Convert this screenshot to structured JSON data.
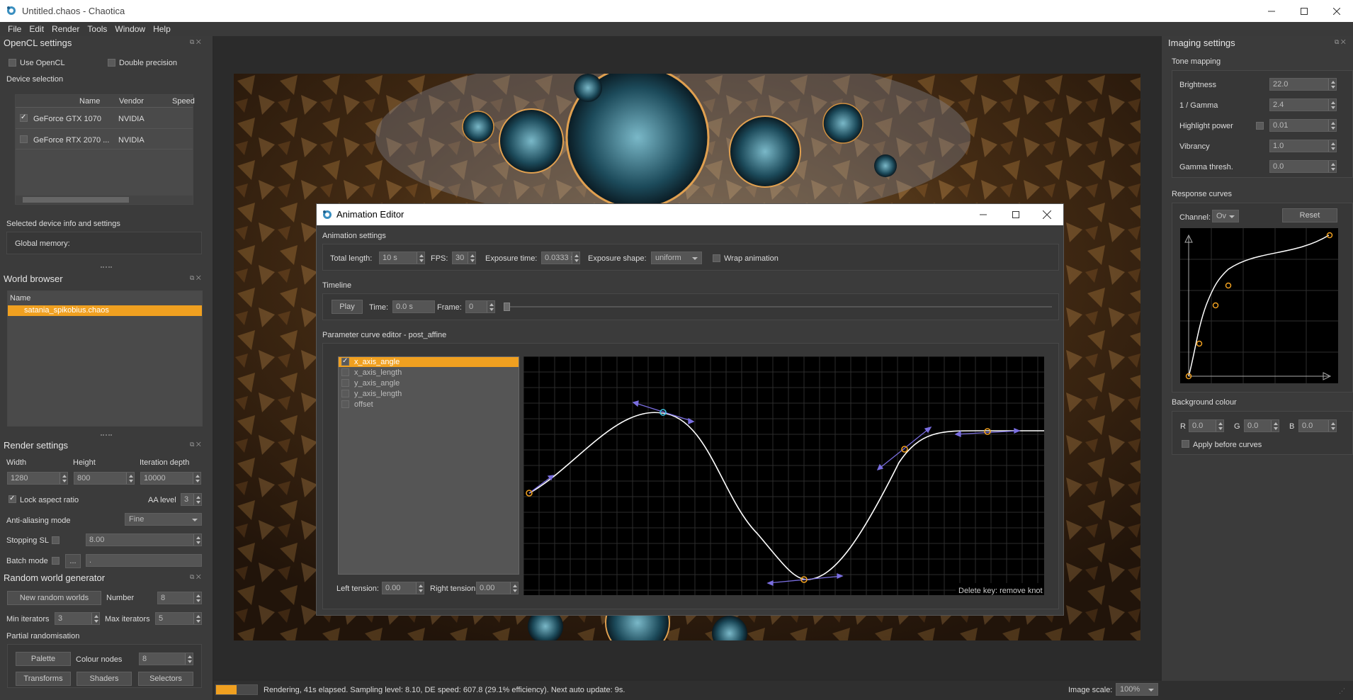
{
  "window": {
    "title": "Untitled.chaos - Chaotica"
  },
  "menu": [
    "File",
    "Edit",
    "Render",
    "Tools",
    "Window",
    "Help"
  ],
  "opencl": {
    "title": "OpenCL settings",
    "use_opencl": "Use OpenCL",
    "double_precision": "Double precision",
    "device_selection": "Device selection",
    "columns": [
      "Name",
      "Vendor",
      "Speed"
    ],
    "devices": [
      {
        "name": "GeForce GTX 1070",
        "vendor": "NVIDIA",
        "checked": true
      },
      {
        "name": "GeForce RTX 2070 ...",
        "vendor": "NVIDIA",
        "checked": false
      }
    ],
    "selected_info": "Selected device info and settings",
    "global_memory": "Global memory:"
  },
  "world_browser": {
    "title": "World browser",
    "column": "Name",
    "items": [
      "satania_spikobius.chaos"
    ]
  },
  "render_settings": {
    "title": "Render settings",
    "width_label": "Width",
    "height_label": "Height",
    "iter_label": "Iteration depth",
    "width": "1280",
    "height": "800",
    "iter": "10000",
    "lock_aspect": "Lock aspect ratio",
    "aa_level_label": "AA level",
    "aa_level": "3",
    "aa_mode_label": "Anti-aliasing mode",
    "aa_mode": "Fine",
    "stopping_sl_label": "Stopping SL",
    "stopping_sl": "8.00",
    "batch_mode_label": "Batch mode",
    "batch_btn": "...",
    "batch_value": "."
  },
  "random_world": {
    "title": "Random world generator",
    "new_btn": "New random worlds",
    "number_label": "Number",
    "number": "8",
    "min_label": "Min iterators",
    "min": "3",
    "max_label": "Max iterators",
    "max": "5",
    "partial": "Partial randomisation",
    "palette_btn": "Palette",
    "colour_nodes_label": "Colour nodes",
    "colour_nodes": "8",
    "transforms_btn": "Transforms",
    "shaders_btn": "Shaders",
    "selectors_btn": "Selectors"
  },
  "imaging": {
    "title": "Imaging settings",
    "tone_mapping": "Tone mapping",
    "rows": [
      {
        "label": "Brightness",
        "value": "22.0"
      },
      {
        "label": "1 / Gamma",
        "value": "2.4"
      },
      {
        "label": "Highlight power",
        "value": "0.01"
      },
      {
        "label": "Vibrancy",
        "value": "1.0"
      },
      {
        "label": "Gamma thresh.",
        "value": "0.0"
      }
    ],
    "response_curves": "Response curves",
    "channel_label": "Channel:",
    "channel": "Ov",
    "reset_btn": "Reset",
    "background": "Background colour",
    "r_label": "R",
    "r": "0.0",
    "g_label": "G",
    "g": "0.0",
    "b_label": "B",
    "b": "0.0",
    "apply_before": "Apply before curves"
  },
  "anim": {
    "title": "Animation Editor",
    "settings": "Animation settings",
    "total_length_label": "Total length:",
    "total_length": "10 s",
    "fps_label": "FPS:",
    "fps": "30",
    "exposure_time_label": "Exposure time:",
    "exposure_time": "0.0333 s",
    "exposure_shape_label": "Exposure shape:",
    "exposure_shape": "uniform",
    "wrap": "Wrap animation",
    "timeline": "Timeline",
    "play_btn": "Play",
    "time_label": "Time:",
    "time": "0.0 s",
    "frame_label": "Frame:",
    "frame": "0",
    "curve_editor": "Parameter curve editor - post_affine",
    "params": [
      {
        "name": "x_axis_angle",
        "checked": true
      },
      {
        "name": "x_axis_length",
        "checked": false
      },
      {
        "name": "y_axis_angle",
        "checked": false
      },
      {
        "name": "y_axis_length",
        "checked": false
      },
      {
        "name": "offset",
        "checked": false
      }
    ],
    "left_tension_label": "Left tension:",
    "left_tension": "0.00",
    "right_tension_label": "Right tension",
    "right_tension": "0.00",
    "hint": "Delete key: remove knot"
  },
  "status": {
    "text": "Rendering, 41s elapsed. Sampling level: 8.10, DE speed: 607.8 (29.1% efficiency). Next auto update: 9s.",
    "progress": 0.5,
    "image_scale_label": "Image scale:",
    "image_scale": "100%"
  },
  "colors": {
    "accent": "#f0a020",
    "bg": "#2a2a2a",
    "panel": "#3b3b3b"
  }
}
